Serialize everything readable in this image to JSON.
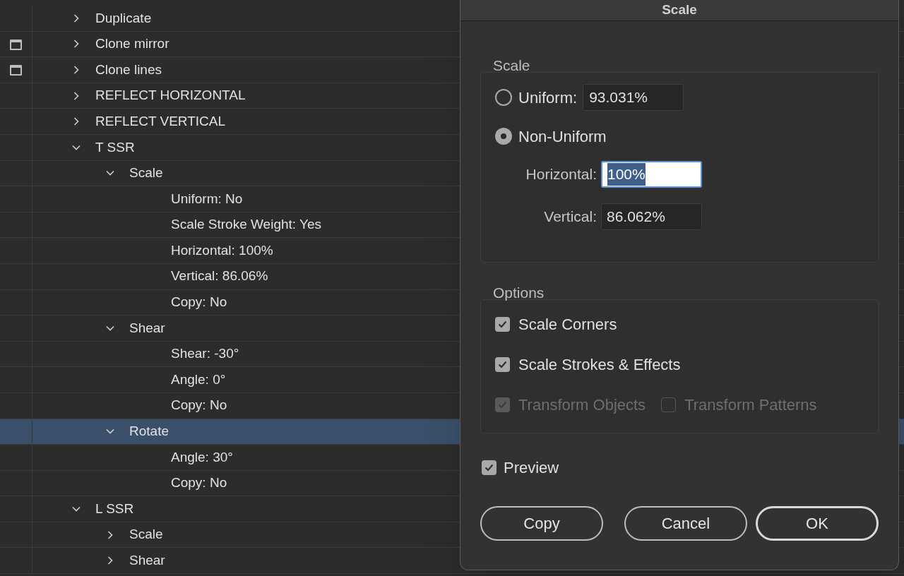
{
  "tree": [
    {
      "label": "Duplicate",
      "expanded": false,
      "selected": false,
      "dialog_toggle": false
    },
    {
      "label": "Clone mirror",
      "expanded": false,
      "selected": false,
      "dialog_toggle": true
    },
    {
      "label": "Clone lines",
      "expanded": false,
      "selected": false,
      "dialog_toggle": true
    },
    {
      "label": "REFLECT HORIZONTAL",
      "expanded": false,
      "selected": false,
      "dialog_toggle": false
    },
    {
      "label": "REFLECT VERTICAL",
      "expanded": false,
      "selected": false,
      "dialog_toggle": false
    },
    {
      "label": "T SSR",
      "expanded": true,
      "selected": false,
      "dialog_toggle": false,
      "children": [
        {
          "label": "Scale",
          "expanded": true,
          "selected": false,
          "children": [
            {
              "label": "Uniform: No",
              "selected": false
            },
            {
              "label": "Scale Stroke Weight: Yes",
              "selected": false
            },
            {
              "label": "Horizontal: 100%",
              "selected": false
            },
            {
              "label": "Vertical: 86.06%",
              "selected": false
            },
            {
              "label": "Copy: No",
              "selected": false
            }
          ]
        },
        {
          "label": "Shear",
          "expanded": true,
          "selected": false,
          "children": [
            {
              "label": "Shear: -30°",
              "selected": false
            },
            {
              "label": "Angle: 0°",
              "selected": false
            },
            {
              "label": "Copy: No",
              "selected": false
            }
          ]
        },
        {
          "label": "Rotate",
          "expanded": true,
          "selected": true,
          "children": [
            {
              "label": "Angle: 30°",
              "selected": false
            },
            {
              "label": "Copy: No",
              "selected": false
            }
          ]
        }
      ]
    },
    {
      "label": "L SSR",
      "expanded": true,
      "selected": false,
      "dialog_toggle": false,
      "children": [
        {
          "label": "Scale",
          "expanded": false,
          "selected": false
        },
        {
          "label": "Shear",
          "expanded": false,
          "selected": false
        }
      ]
    }
  ],
  "dialog": {
    "title": "Scale",
    "scale_group": {
      "label": "Scale",
      "options": [
        {
          "label": "Uniform:",
          "selected": false,
          "value": "93.031%"
        },
        {
          "label": "Non-Uniform",
          "selected": true
        }
      ],
      "fields": [
        {
          "label": "Horizontal:",
          "value": "100%",
          "focused": true
        },
        {
          "label": "Vertical:",
          "value": "86.062%",
          "focused": false
        }
      ]
    },
    "options_group": {
      "label": "Options",
      "rows": [
        [
          {
            "label": "Scale Corners",
            "checked": true,
            "disabled": false
          }
        ],
        [
          {
            "label": "Scale Strokes & Effects",
            "checked": true,
            "disabled": false
          }
        ],
        [
          {
            "label": "Transform Objects",
            "checked": true,
            "disabled": true
          },
          {
            "label": "Transform Patterns",
            "checked": false,
            "disabled": true
          }
        ]
      ]
    },
    "preview": {
      "label": "Preview",
      "checked": true
    },
    "buttons": [
      {
        "label": "Copy",
        "default": false
      },
      {
        "label": "Cancel",
        "default": false
      },
      {
        "label": "OK",
        "default": true
      }
    ]
  }
}
